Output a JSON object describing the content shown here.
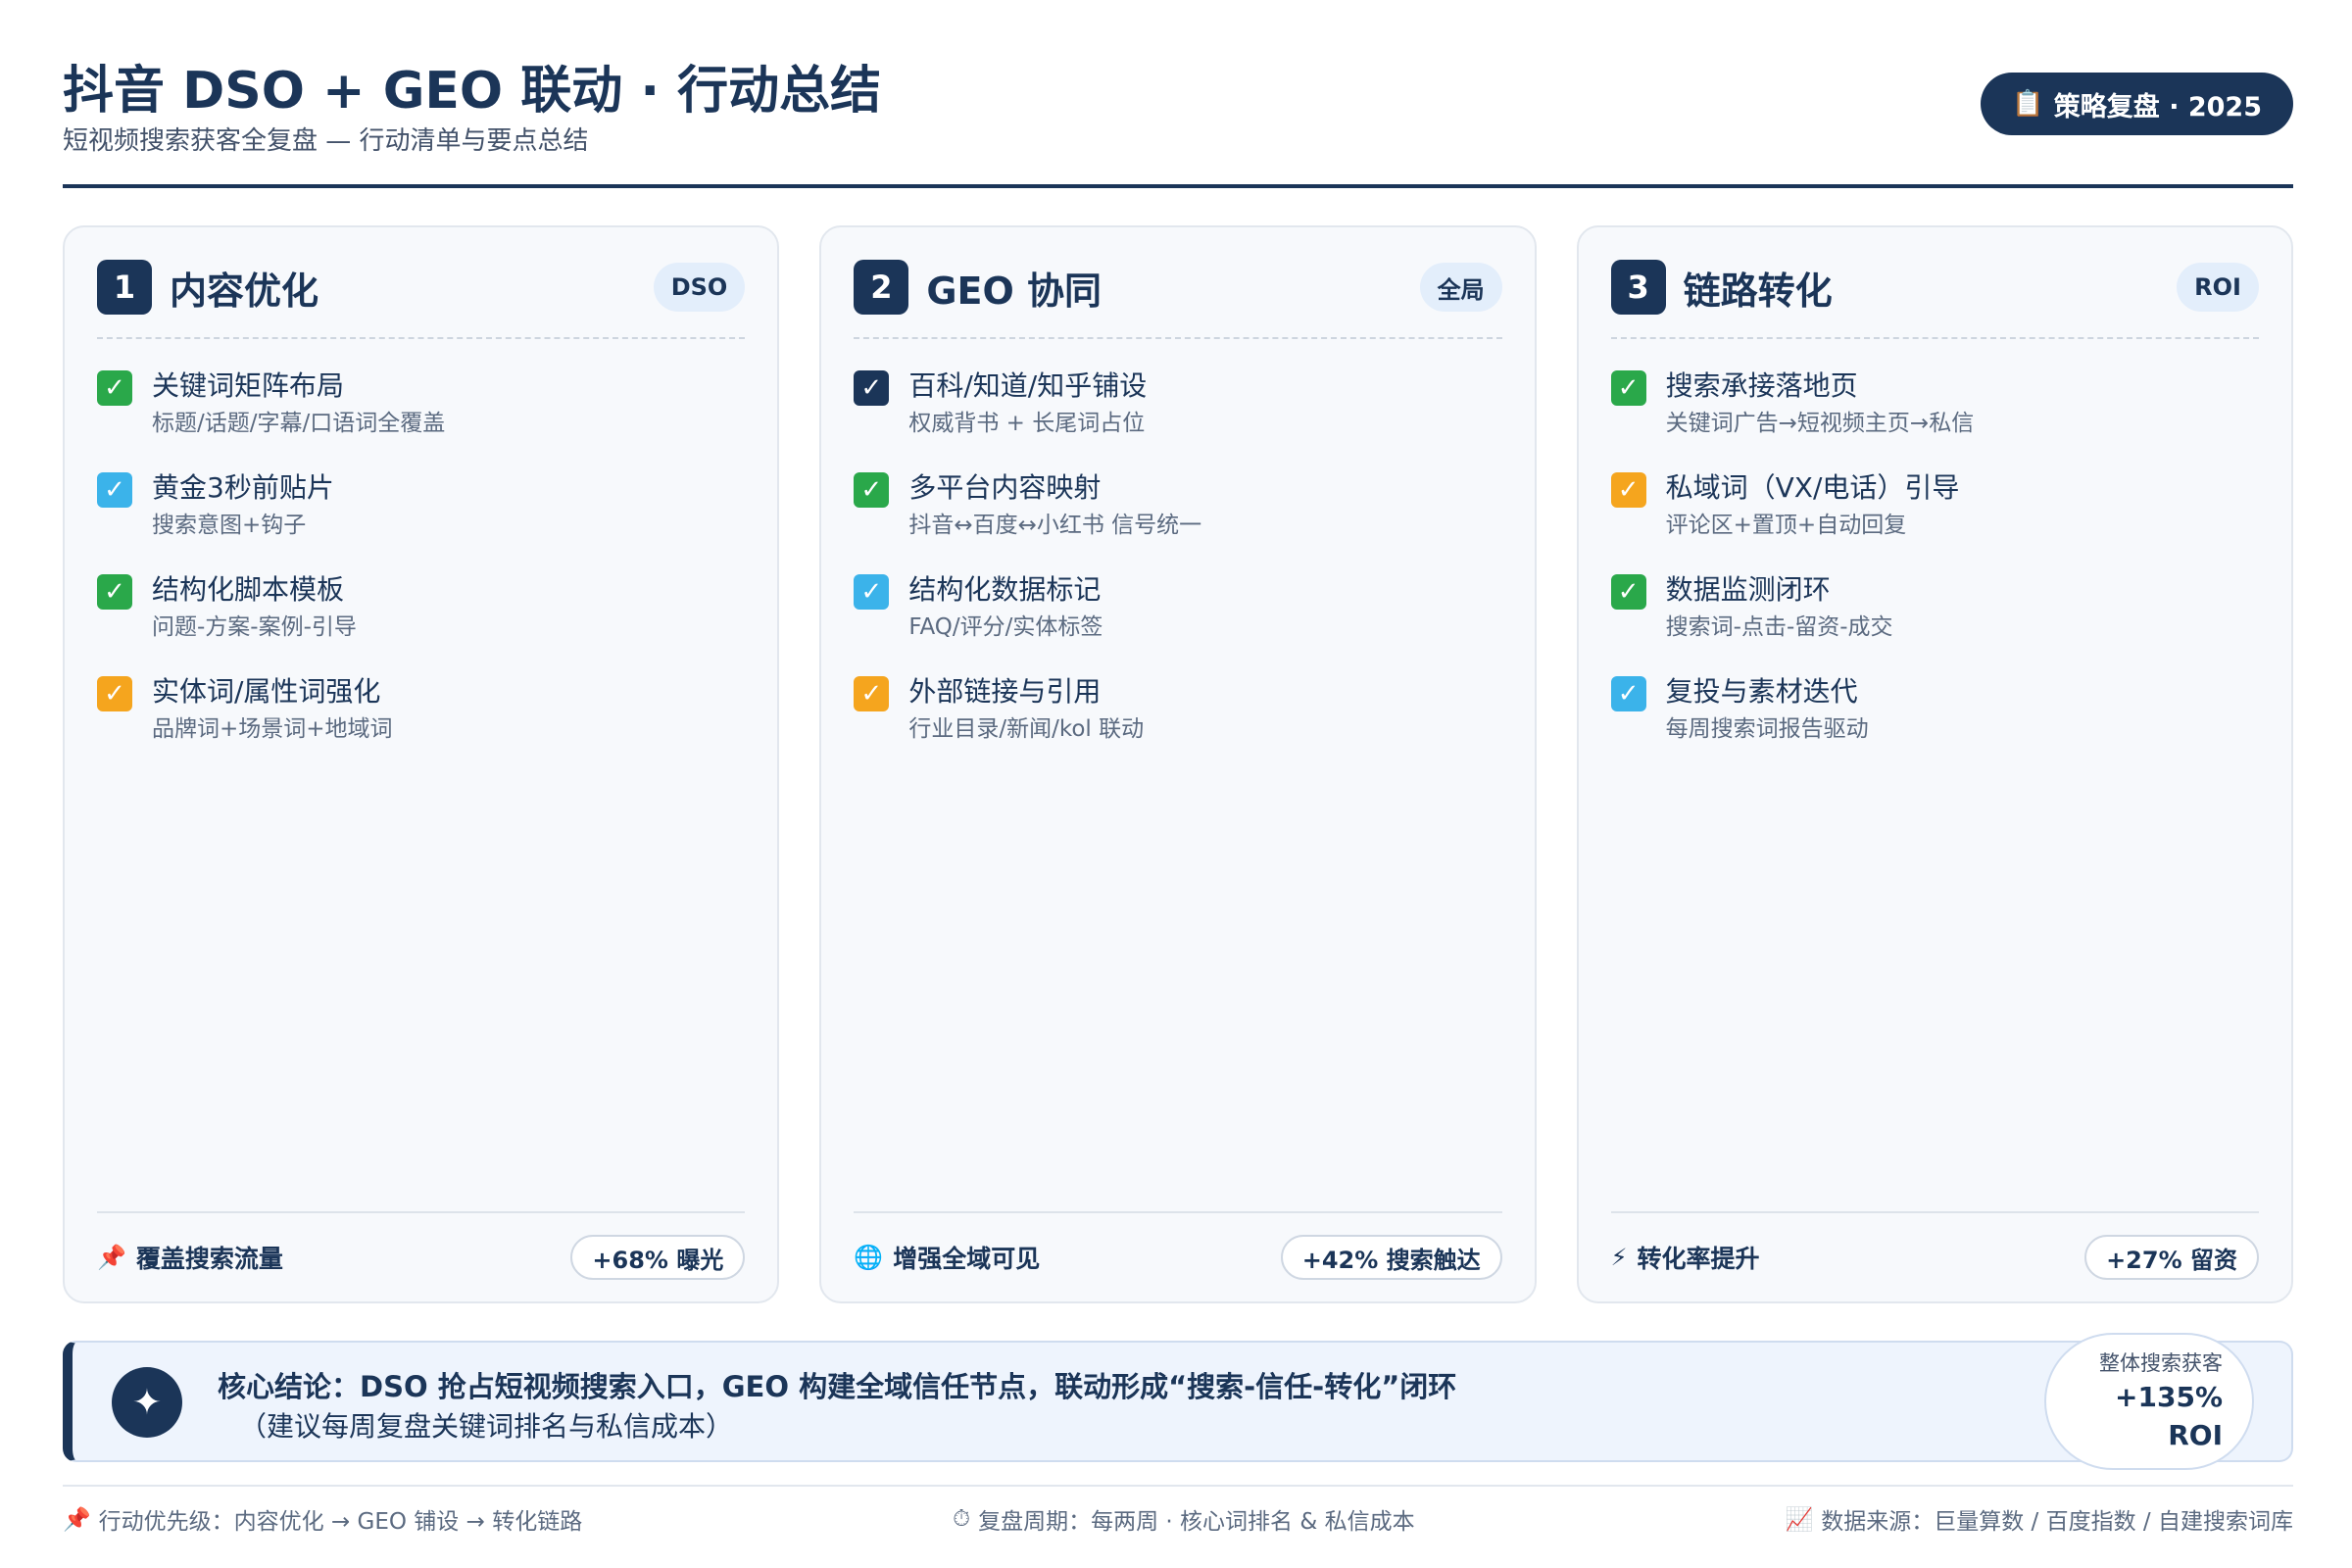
{
  "header": {
    "title": "抖音 DSO + GEO 联动 · 行动总结",
    "subtitle": "短视频搜索获客全复盘 — 行动清单与要点总结",
    "badge": "策略复盘 · 2025",
    "badge_icon": "📋"
  },
  "cards": [
    {
      "number": "1",
      "title": "内容优化",
      "tag": "DSO",
      "items": [
        {
          "title": "关键词矩阵布局",
          "sub": "标题/话题/字幕/口语词全覆盖",
          "status": "green"
        },
        {
          "title": "黄金3秒前贴片",
          "sub": "搜索意图+钩子",
          "status": "blue"
        },
        {
          "title": "结构化脚本模板",
          "sub": "问题-方案-案例-引导",
          "status": "green"
        },
        {
          "title": "实体词/属性词强化",
          "sub": "品牌词+场景词+地域词",
          "status": "orange"
        }
      ],
      "footer": {
        "icon": "📌",
        "label": "覆盖搜索流量",
        "badge": "+68% 曝光"
      }
    },
    {
      "number": "2",
      "title": "GEO 协同",
      "tag": "全局",
      "items": [
        {
          "title": "百科/知道/知乎铺设",
          "sub": "权威背书 + 长尾词占位",
          "status": "navy"
        },
        {
          "title": "多平台内容映射",
          "sub": "抖音↔百度↔小红书 信号统一",
          "status": "green"
        },
        {
          "title": "结构化数据标记",
          "sub": "FAQ/评分/实体标签",
          "status": "blue"
        },
        {
          "title": "外部链接与引用",
          "sub": "行业目录/新闻/kol 联动",
          "status": "orange"
        }
      ],
      "footer": {
        "icon": "🌐",
        "label": "增强全域可见",
        "badge": "+42% 搜索触达"
      }
    },
    {
      "number": "3",
      "title": "链路转化",
      "tag": "ROI",
      "items": [
        {
          "title": "搜索承接落地页",
          "sub": "关键词广告→短视频主页→私信",
          "status": "green"
        },
        {
          "title": "私域词（VX/电话）引导",
          "sub": "评论区+置顶+自动回复",
          "status": "orange"
        },
        {
          "title": "数据监测闭环",
          "sub": "搜索词-点击-留资-成交",
          "status": "green"
        },
        {
          "title": "复投与素材迭代",
          "sub": "每周搜索词报告驱动",
          "status": "blue"
        }
      ],
      "footer": {
        "icon": "⚡",
        "label": "转化率提升",
        "badge": "+27% 留资"
      }
    }
  ],
  "check_glyph": "✓",
  "summary": {
    "icon": "✦",
    "main": "核心结论：DSO 抢占短视频搜索入口，GEO 构建全域信任节点，联动形成“搜索-信任-转化”闭环",
    "note": "（建议每周复盘关键词排名与私信成本）",
    "roi_label": "整体搜索获客",
    "roi_value": "+135%",
    "roi_unit": "ROI"
  },
  "footer": {
    "left_icon": "📌",
    "left": "行动优先级：内容优化 → GEO 铺设 → 转化链路",
    "center_icon": "⏱",
    "center": "复盘周期：每两周 · 核心词排名 & 私信成本",
    "right_icon": "📈",
    "right": "数据来源：巨量算数 / 百度指数 / 自建搜索词库"
  },
  "colors": {
    "navy": "#1b3558",
    "green": "#2aa84a",
    "blue": "#3bb3ea",
    "orange": "#f5a51e"
  }
}
